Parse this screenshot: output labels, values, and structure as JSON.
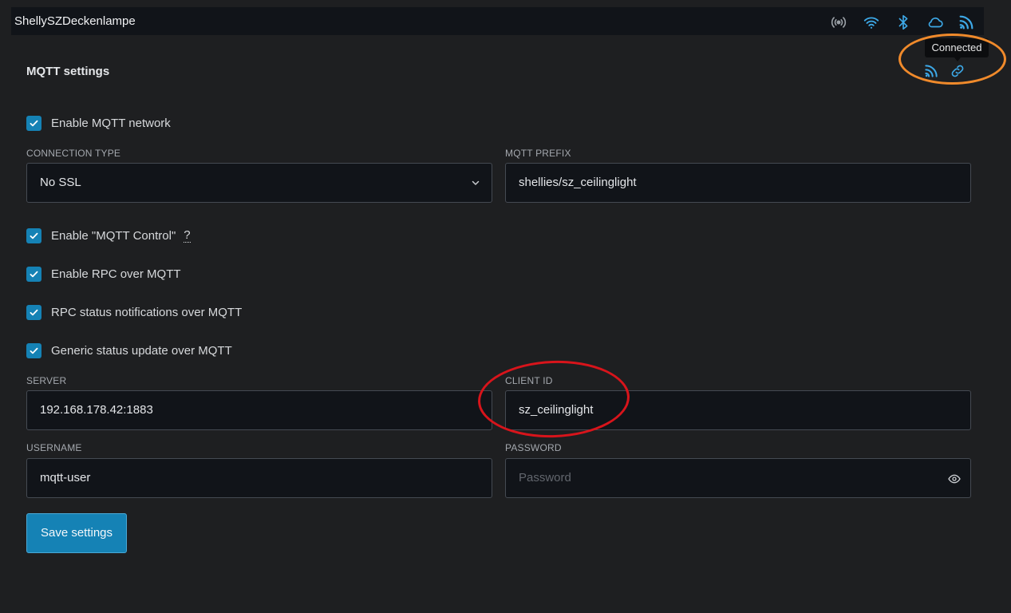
{
  "header": {
    "device_name": "ShellySZDeckenlampe",
    "icons": [
      "broadcast-icon",
      "wifi-icon",
      "bluetooth-icon",
      "cloud-icon",
      "rss-icon"
    ]
  },
  "tooltip": {
    "text": "Connected",
    "icons": [
      "mqtt-rss-icon",
      "link-icon"
    ]
  },
  "page": {
    "title": "MQTT settings"
  },
  "form": {
    "enable_mqtt": {
      "label": "Enable MQTT network",
      "checked": true
    },
    "connection_type": {
      "label": "CONNECTION TYPE",
      "value": "No SSL"
    },
    "mqtt_prefix": {
      "label": "MQTT PREFIX",
      "value": "shellies/sz_ceilinglight"
    },
    "enable_mqtt_control": {
      "label": "Enable \"MQTT Control\"",
      "help": "?",
      "checked": true
    },
    "enable_rpc": {
      "label": "Enable RPC over MQTT",
      "checked": true
    },
    "rpc_status": {
      "label": "RPC status notifications over MQTT",
      "checked": true
    },
    "generic_status": {
      "label": "Generic status update over MQTT",
      "checked": true
    },
    "server": {
      "label": "SERVER",
      "value": "192.168.178.42:1883"
    },
    "client_id": {
      "label": "CLIENT ID",
      "value": "sz_ceilinglight"
    },
    "username": {
      "label": "USERNAME",
      "value": "mqtt-user"
    },
    "password": {
      "label": "PASSWORD",
      "value": "",
      "placeholder": "Password"
    },
    "save_label": "Save settings"
  },
  "colors": {
    "accent": "#1582b5",
    "icon_blue": "#3da9e8",
    "highlight_orange": "#f08a2b",
    "highlight_red": "#d8141b"
  }
}
